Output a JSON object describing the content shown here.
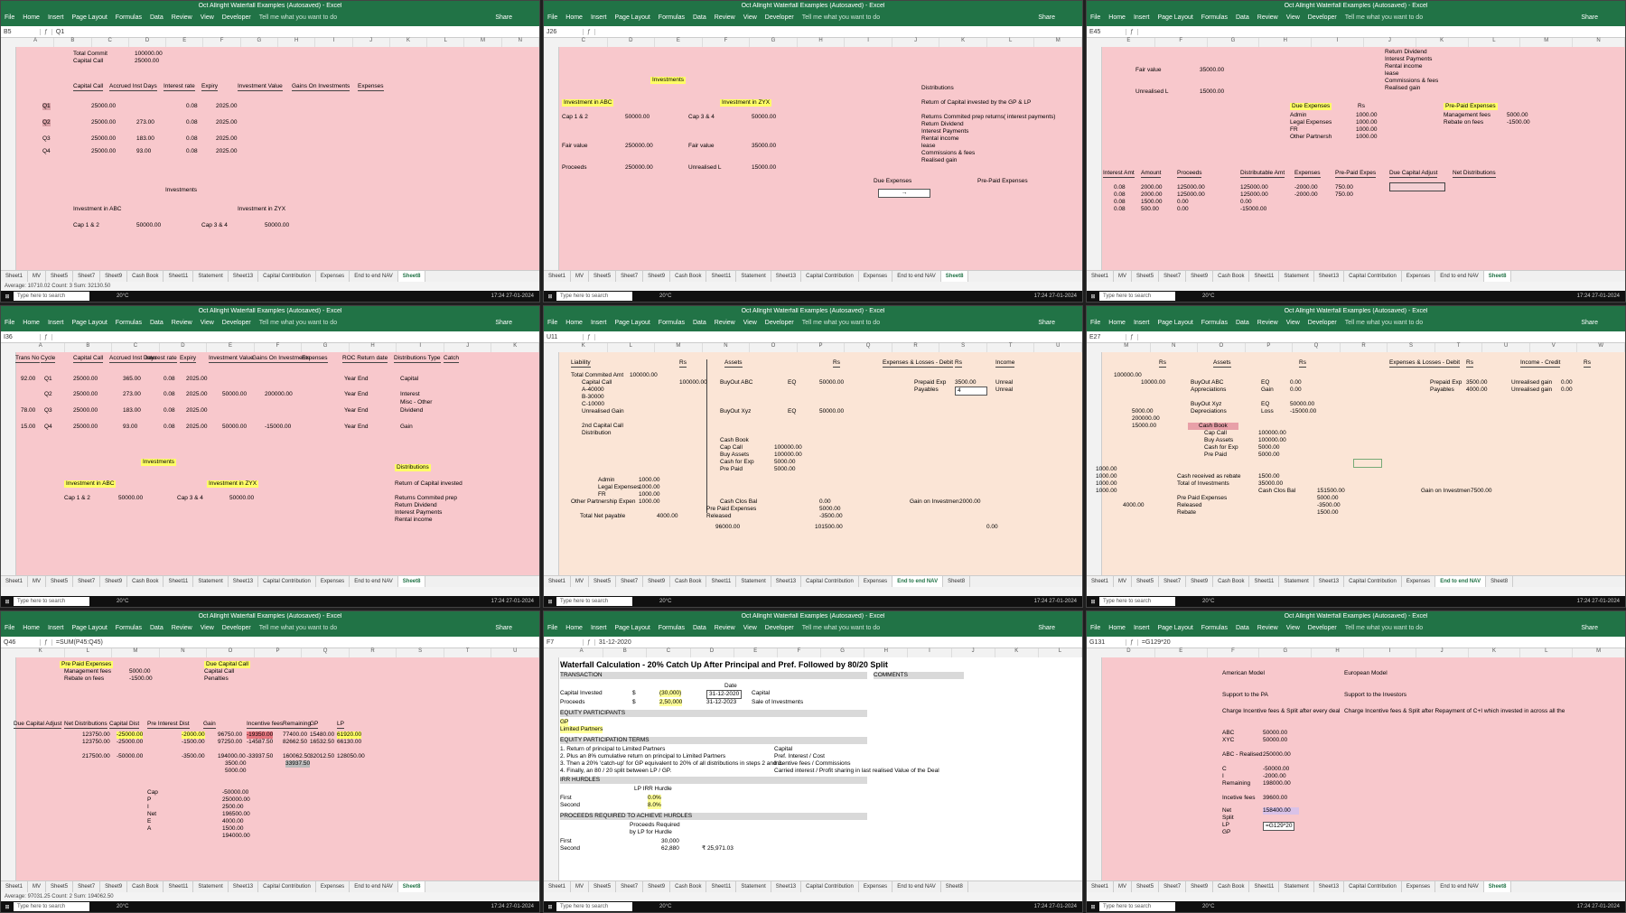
{
  "window": {
    "title": "Oct Allright Waterfall Examples (Autosaved) - Excel",
    "menu": [
      "File",
      "Home",
      "Insert",
      "Page Layout",
      "Formulas",
      "Data",
      "Review",
      "View",
      "Developer"
    ],
    "tell_me": "Tell me what you want to do",
    "share": "Share"
  },
  "taskbar": {
    "search_placeholder": "Type here to search",
    "weather": "20°C",
    "clock": "17:24 27-01-2024",
    "lang": "ENG"
  },
  "sheet_tabs": [
    "Sheet1",
    "MV",
    "Sheet5",
    "Sheet7",
    "Sheet9",
    "Cash Book",
    "Sheet11",
    "Statement",
    "Sheet13",
    "Capital Contribution",
    "Expenses",
    "End to end NAV",
    "Sheet8"
  ],
  "panes": [
    {
      "id": "p1",
      "namebox": "B5",
      "formula": "Q1",
      "cols": [
        "A",
        "B",
        "C",
        "D",
        "E",
        "F",
        "G",
        "H",
        "I",
        "J",
        "K",
        "L",
        "M",
        "N"
      ],
      "active_tab": "Sheet8",
      "cells": {
        "total_commit": "Total Commit",
        "total_commit_v": "100000.00",
        "capital_call": "Capital Call",
        "capital_call_v": "25000.00",
        "h_capcall": "Capital Call",
        "h_accr": "Accrued Inst Days",
        "h_rate": "Interest rate",
        "h_expiry": "Expiry",
        "h_inv": "Investment Value",
        "h_gain": "Gains On Investments",
        "h_exp": "Expenses",
        "q1": "Q1",
        "q2": "Q2",
        "q3": "Q3",
        "q4": "Q4",
        "r1": [
          "25000.00",
          "",
          "0.08",
          "2025.00"
        ],
        "r2": [
          "25000.00",
          "273.00",
          "0.08",
          "2025.00"
        ],
        "r3": [
          "25000.00",
          "183.00",
          "0.08",
          "2025.00"
        ],
        "r4": [
          "25000.00",
          "93.00",
          "0.08",
          "2025.00"
        ],
        "investments": "Investments",
        "inv_abc": "Investment in ABC",
        "inv_zyx": "Investment in ZYX",
        "cap12": "Cap 1 & 2",
        "cap12_v": "50000.00",
        "cap34": "Cap 3 & 4",
        "cap34_v": "50000.00"
      },
      "status": "Average: 10710.02   Count: 3   Sum: 32130.50"
    },
    {
      "id": "p2",
      "namebox": "J26",
      "formula": "",
      "cols": [
        "C",
        "D",
        "E",
        "F",
        "G",
        "H",
        "I",
        "J",
        "K",
        "L",
        "M"
      ],
      "active_tab": "Sheet8",
      "cells": {
        "investments": "Investments",
        "inv_abc": "Investment in ABC",
        "inv_zyx": "Investment in ZYX",
        "cap12": "Cap 1 & 2",
        "cap12_v": "50000.00",
        "cap34": "Cap 3 & 4",
        "cap34_v": "50000.00",
        "fv": "Fair value",
        "fv_v": "250000.00",
        "fv2": "Fair value",
        "fv2_v": "35000.00",
        "proc": "Proceeds",
        "proc_v": "250000.00",
        "unr": "Unrealised L",
        "unr_v": "15000.00",
        "distributions": "Distributions",
        "ret_cap": "Return of Capital invested by the GP & LP",
        "d1": "Returns Commited prep returns( interest payments)",
        "d2": "Return Dividend",
        "d3": "Interest Payments",
        "d4": "Rental income",
        "d5": "lease",
        "d6": "Commissions & fees",
        "d7": "Realised gain",
        "due_exp": "Due Expenses",
        "pre_paid": "Pre-Paid Expenses"
      },
      "status": ""
    },
    {
      "id": "p3",
      "namebox": "E45",
      "formula": "",
      "cols": [
        "E",
        "F",
        "G",
        "H",
        "I",
        "J",
        "K",
        "L",
        "M",
        "N"
      ],
      "active_tab": "Sheet8",
      "cells": {
        "rd": "Return Dividend",
        "ip": "Interest Payments",
        "ri": "Rental income",
        "ls": "lease",
        "cf": "Commissions & fees",
        "rg": "Realised gain",
        "fv": "Fair value",
        "fv_v": "35000.00",
        "unr": "Unrealised L",
        "unr_v": "15000.00",
        "due_exp": "Due Expenses",
        "rs": "Rs",
        "admin": "Admin",
        "admin_v": "1000.00",
        "legal": "Legal Expenses",
        "legal_v": "1000.00",
        "fr": "FR",
        "fr_v": "1000.00",
        "other": "Other Partnersh",
        "other_v": "1000.00",
        "pre_paid": "Pre-Paid Expenses",
        "mgmt": "Management fees",
        "mgmt_v": "5000.00",
        "rebate": "Rebate on fees",
        "rebate_v": "-1500.00",
        "h": [
          "Interest Amt",
          "Amount",
          "Proceeds",
          "Distributable Amt",
          "Expenses",
          "Pre-Paid Expes",
          "Due Capital Adjust",
          "Net Distributions"
        ],
        "rows": [
          [
            "0.08",
            "2000.00",
            "125000.00",
            "125000.00",
            "-2000.00",
            "750.00"
          ],
          [
            "0.08",
            "2000.00",
            "125000.00",
            "125000.00",
            "-2000.00",
            "750.00"
          ],
          [
            "0.08",
            "1500.00",
            "0.00",
            "0.00",
            "",
            ""
          ],
          [
            "0.08",
            "500.00",
            "0.00",
            "-15000.00",
            "",
            ""
          ]
        ]
      },
      "status": ""
    },
    {
      "id": "p4",
      "namebox": "I36",
      "formula": "",
      "cols": [
        "A",
        "B",
        "C",
        "D",
        "E",
        "F",
        "G",
        "H",
        "I",
        "J",
        "K"
      ],
      "active_tab": "Sheet8",
      "cells": {
        "h": [
          "Trans No",
          "Cycle",
          "Capital Call",
          "Accrued Inst Days",
          "Interest rate",
          "Expiry",
          "Investment Value",
          "Gains On Investments",
          "Expenses",
          "ROC Return date",
          "Distributions Type",
          "Catch"
        ],
        "rows": [
          [
            "92.00",
            "Q1",
            "25000.00",
            "365.00",
            "0.08",
            "2025.00",
            "",
            "",
            "",
            "Year End",
            "Capital"
          ],
          [
            "",
            "Q2",
            "25000.00",
            "273.00",
            "0.08",
            "2025.00",
            "50000.00",
            "200000.00",
            "",
            "Year End",
            "Interest"
          ],
          [
            "78.00",
            "Q3",
            "25000.00",
            "183.00",
            "0.08",
            "2025.00",
            "",
            "",
            "",
            "Year End",
            "Dividend"
          ],
          [
            "15.00",
            "Q4",
            "25000.00",
            "93.00",
            "0.08",
            "2025.00",
            "50000.00",
            "-15000.00",
            "",
            "Year End",
            "Gain"
          ]
        ],
        "misc_other": "Misc - Other",
        "investments": "Investments",
        "distributions": "Distributions",
        "inv_abc": "Investment in ABC",
        "inv_zyx": "Investment in ZYX",
        "cap12": "Cap 1 & 2",
        "cap12_v": "50000.00",
        "cap34": "Cap 3 & 4",
        "cap34_v": "50000.00",
        "ret_cap": "Return of Capital invested",
        "d1": "Returns Commited prep",
        "d2": "Return Dividend",
        "d3": "Interest Payments",
        "d4": "Rental income"
      },
      "status": ""
    },
    {
      "id": "p5",
      "namebox": "U11",
      "formula": "",
      "cols": [
        "K",
        "L",
        "M",
        "N",
        "O",
        "P",
        "Q",
        "R",
        "S",
        "T",
        "U"
      ],
      "active_tab": "End to end NAV",
      "cells": {
        "liab": "Liability",
        "rs": "Rs",
        "assets": "Assets",
        "rs2": "Rs",
        "tca": "Total Commited Amt",
        "tca_v": "100000.00",
        "cc": "Capital Call",
        "cc_v": "100000.00",
        "a": "A-40000",
        "b": "B-30000",
        "c": "C-10000",
        "unrg": "Unrealised Gain",
        "cap2": "2nd Capital Call",
        "dist": "Distribution",
        "buyabc": "BuyOut ABC",
        "eq": "EQ",
        "eq_v": "50000.00",
        "buyxyz": "BuyOut Xyz",
        "eq2": "EQ",
        "eq2_v": "50000.00",
        "cashbook": "Cash Book",
        "capcall": "Cap Call",
        "capcall_v": "100000.00",
        "buyassets": "Buy Assets",
        "buyassets_v": "100000.00",
        "cashexp": "Cash for Exp",
        "cashexp_v": "5000.00",
        "prepaid": "Pre Paid",
        "prepaid_v": "5000.00",
        "admin": "Admin",
        "admin_v": "1000.00",
        "legal": "Legal Expenses",
        "legal_v": "1000.00",
        "fr": "FR",
        "fr_v": "1000.00",
        "other": "Other Partnership Expen",
        "other_v": "1000.00",
        "tnp": "Total Net payable",
        "tnp_v": "4000.00",
        "ccb": "Cash Clos Bal",
        "ccb_v": "0.00",
        "ppe": "Pre Paid Expenses",
        "ppe_v": "5000.00",
        "relsd": "Released",
        "relsd_v": "-3500.00",
        "pl": "Expenses & Losses - Debit",
        "rs3": "Rs",
        "inc": "Income",
        "prexp": "Prepaid Exp",
        "prexp_v": "3500.00",
        "pay": "Payables",
        "pay_v": "4",
        "unr1": "Unreal",
        "unr2": "Unreal",
        "goi": "Gain on Investmen",
        "goi_v": "2000.00",
        "tot1": "96000.00",
        "tot2": "101500.00",
        "tot3": "0.00"
      },
      "status": ""
    },
    {
      "id": "p6",
      "namebox": "E27",
      "formula": "",
      "cols": [
        "M",
        "N",
        "O",
        "P",
        "Q",
        "R",
        "S",
        "T",
        "U",
        "V",
        "W"
      ],
      "active_tab": "End to end NAV",
      "cells": {
        "rs": "Rs",
        "assets": "Assets",
        "rs2": "Rs",
        "v10": "100000.00",
        "buyabc": "BuyOut ABC",
        "eq": "EQ",
        "eq_v": "0.00",
        "appr": "Appreciations",
        "gain": "Gain",
        "gain_v": "0.00",
        "buyxyz": "BuyOut Xyz",
        "eq2": "EQ",
        "eq2_v": "50000.00",
        "depr": "Depreciations",
        "loss": "Loss",
        "loss_v": "-15000.00",
        "cashbook": "Cash Book",
        "capcall": "Cap Call",
        "capcall_v": "100000.00",
        "buyassets": "Buy Assets",
        "buyassets_v": "100000.00",
        "cashexp": "Cash for Exp",
        "cashexp_v": "5000.00",
        "prepaid": "Pre Paid",
        "prepaid_v": "5000.00",
        "cashreb": "Cash received as rebate",
        "cashreb_v": "1500.00",
        "toi": "Total of Investments",
        "toi_v": "35000.00",
        "ccb": "Cash Clos Bal",
        "ccb_v": "151500.00",
        "ppe": "Pre Paid Expenses",
        "ppe_v": "5000.00",
        "relsd": "Released",
        "relsd_v": "-3500.00",
        "reb": "Rebate",
        "reb_v": "1500.00",
        "left": [
          "10000.00",
          "5000.00",
          "200000.00",
          "15000.00",
          "1000.00",
          "1000.00",
          "1000.00",
          "1000.00",
          "4000.00"
        ],
        "pl": "Expenses & Losses - Debit",
        "rs3": "Rs",
        "inc": "Income - Credit",
        "rs4": "Rs",
        "prexp": "Prepaid Exp",
        "prexp_v": "3500.00",
        "pay": "Payables",
        "pay_v": "4000.00",
        "ug1": "Unrealised gain",
        "ug1_v": "0.00",
        "ug2": "Unrealised gain",
        "ug2_v": "0.00",
        "goi": "Gain on Investmen",
        "goi_v": "7500.00"
      },
      "status": ""
    },
    {
      "id": "p7",
      "namebox": "Q46",
      "formula": "=SUM(P45:Q45)",
      "cols": [
        "K",
        "L",
        "M",
        "N",
        "O",
        "P",
        "Q",
        "R",
        "S",
        "T",
        "U"
      ],
      "active_tab": "Sheet8",
      "cells": {
        "pre_paid": "Pre Paid Expenses",
        "mgmt": "Management fees",
        "mgmt_v": "5000.00",
        "rebate": "Rebate on fees",
        "rebate_v": "-1500.00",
        "due_cc": "Due Capital Call",
        "capcall": "Capital Call",
        "pen": "Penalties",
        "h": [
          "Due Capital Adjust",
          "Net Distributions",
          "Capital Dist",
          "Pre Interest Dist",
          "Gain",
          "Incentive fees",
          "Remaining",
          "GP",
          "LP"
        ],
        "r1": [
          "123750.00",
          "-25000.00",
          "-2000.00",
          "96750.00",
          "-19350.00",
          "77400.00",
          "15480.00",
          "61920.00"
        ],
        "r2": [
          "123750.00",
          "-25000.00",
          "-1500.00",
          "97250.00",
          "-14587.50",
          "82662.50",
          "16532.50",
          "66130.00"
        ],
        "r3": [
          "217500.00",
          "-50000.00",
          "-3500.00",
          "194000.00",
          "-33937.50",
          "160062.50",
          "32012.50",
          "128050.00"
        ],
        "r4a": "3500.00",
        "r4b": "5000.00",
        "r4c": "33937.50",
        "cap": "Cap",
        "cap_v": "-50000.00",
        "p": "P",
        "p_v": "250000.00",
        "i": "I",
        "i_v": "2500.00",
        "net": "Net",
        "net_v": "196500.00",
        "e": "E",
        "e_v": "4000.00",
        "a": "A",
        "a_v": "1500.00",
        "last_v": "194000.00"
      },
      "status": "Average: 97031.25   Count: 2   Sum: 194062.50"
    },
    {
      "id": "p8",
      "namebox": "F7",
      "formula": "31-12-2020",
      "cols": [
        "A",
        "B",
        "C",
        "D",
        "E",
        "F",
        "G",
        "H",
        "I",
        "J",
        "K",
        "L"
      ],
      "active_tab": "Waterfall - GMT Fund X",
      "cells": {
        "title": "Waterfall Calculation - 20% Catch Up After Principal and Pref. Followed by 80/20 Split",
        "ti": "TRANSACTION",
        "comments": "COMMENTS",
        "date": "Date",
        "ci": "Capital Invested",
        "ci_d": "$",
        "ci_v": "(30,000)",
        "ci_date": "31-12-2020",
        "ci_c": "Capital",
        "pr": "Proceeds",
        "pr_d": "$",
        "pr_v": "2,50,000",
        "pr_date": "31-12-2023",
        "pr_c": "Sale of Investments",
        "ep": "EQUITY PARTICIPANTS",
        "gp": "GP",
        "lp": "Limited Partners",
        "ept": "EQUITY PARTICIPATION TERMS",
        "t1": "1. Return of principal to Limited Partners",
        "t1c": "Capital",
        "t2": "2. Plus an 8% cumulative return on principal to Limited Partners",
        "t2c": "Pref. Interest / Cost",
        "t3": "3. Then a 20% 'catch-up' for GP equivalent to 20% of all distributions in steps 2 and 3.",
        "t3c": "Incentive fees / Commissions",
        "t4": "4. Finally, an 80 / 20 split between LP / GP.",
        "t4c": "Carried interest / Profit sharing in last realised Value of the Deal",
        "irrh": "IRR HURDLES",
        "lpirr": "LP IRR Hurdle",
        "first": "First",
        "first_v": "0.0%",
        "second": "Second",
        "second_v": "8.0%",
        "prah": "PROCEEDS REQUIRED TO ACHIEVE HURDLES",
        "preq": "Proceeds Required",
        "bylp": "by LP for Hurdle",
        "first2": "First",
        "first2_v": "30,000",
        "second2": "Second",
        "second2_v": "62,880",
        "second2_x": "₹ 25,971.03"
      },
      "status": ""
    },
    {
      "id": "p9",
      "namebox": "G131",
      "formula": "=G129*20",
      "cols": [
        "D",
        "E",
        "F",
        "G",
        "H",
        "I",
        "J",
        "K",
        "L",
        "M"
      ],
      "active_tab": "Sheet8",
      "cells": {
        "am": "American Model",
        "em": "European Model",
        "sgp": "Support to the PA",
        "sinv": "Support to the Investors",
        "cif": "Charge Incentive fees & Split after every deal",
        "cif2": "Charge Incentive fees & Split after Repayment of C+I which invested in across all the",
        "abc": "ABC",
        "abc_v": "50000.00",
        "xyc": "XYC",
        "xyc_v": "50000.00",
        "abcr": "ABC - Realised",
        "abcr_v": "250000.00",
        "c": "C",
        "c_v": "-50000.00",
        "i": "I",
        "i_v": "-2000.00",
        "rem": "Remaining",
        "rem_v": "198000.00",
        "inc": "Incetive fees",
        "inc_v": "39600.00",
        "net": "Net",
        "net_v": "158400.00",
        "split": "Split",
        "lp": "LP",
        "lp_v": "=G129*20",
        "gp": "GP"
      },
      "status": ""
    }
  ]
}
